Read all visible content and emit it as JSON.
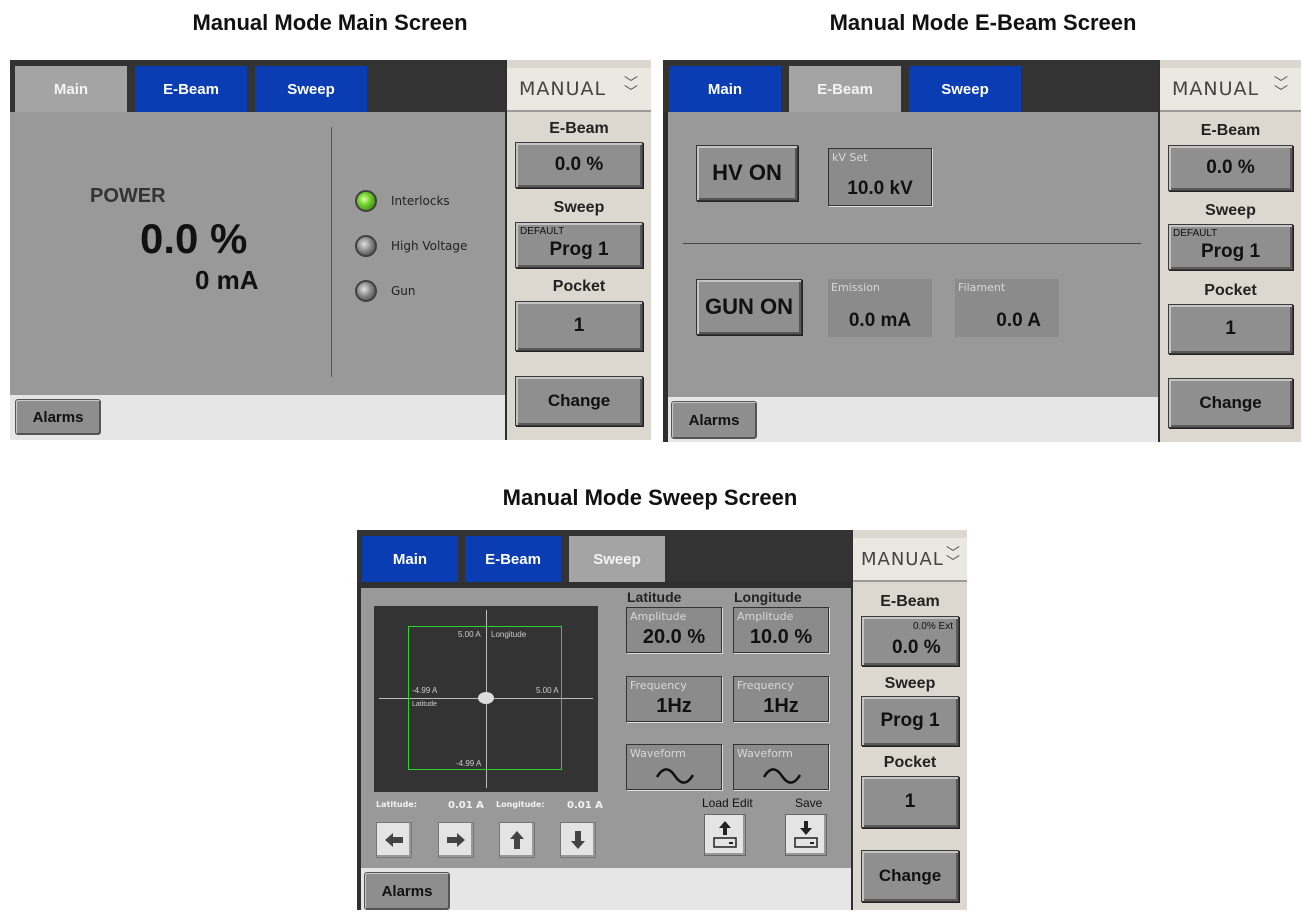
{
  "captions": {
    "main": "Manual Mode Main Screen",
    "ebeam": "Manual Mode E-Beam Screen",
    "sweep": "Manual Mode Sweep Screen"
  },
  "tabs": {
    "main": "Main",
    "ebeam": "E-Beam",
    "sweep": "Sweep"
  },
  "side": {
    "mode": "MANUAL",
    "ebeam_label": "E-Beam",
    "ebeam_value": "0.0 %",
    "ebeam_ext": "0.0% Ext",
    "sweep_label": "Sweep",
    "sweep_default": "DEFAULT",
    "sweep_prog": "Prog 1",
    "pocket_label": "Pocket",
    "pocket_value": "1",
    "change": "Change"
  },
  "alarms": "Alarms",
  "main_screen": {
    "power_label": "POWER",
    "power_value": "0.0 %",
    "current_value": "0 mA",
    "leds": [
      {
        "label": "Interlocks",
        "state": "green"
      },
      {
        "label": "High Voltage",
        "state": "off"
      },
      {
        "label": "Gun",
        "state": "off"
      }
    ]
  },
  "ebeam_screen": {
    "hv_button": "HV ON",
    "kv_label": "kV Set",
    "kv_value": "10.0 kV",
    "gun_button": "GUN ON",
    "emission_label": "Emission",
    "emission_value": "0.0 mA",
    "filament_label": "Filament",
    "filament_value": "0.0 A"
  },
  "sweep_screen": {
    "plot": {
      "top": "5.00 A",
      "longitude_axis": "Longitude",
      "left": "-4.99 A",
      "right": "5.00 A",
      "latitude_axis": "Latitude",
      "bottom": "-4.99 A"
    },
    "latitude_header": "Latitude",
    "longitude_header": "Longitude",
    "amplitude_label": "Amplitude",
    "lat_amplitude": "20.0 %",
    "lon_amplitude": "10.0 %",
    "frequency_label": "Frequency",
    "lat_frequency": "1Hz",
    "lon_frequency": "1Hz",
    "waveform_label": "Waveform",
    "step_lat_label": "Latitude:",
    "step_lat_value": "0.01 A",
    "step_lon_label": "Longitude:",
    "step_lon_value": "0.01 A",
    "load_edit": "Load Edit",
    "save": "Save"
  },
  "colors": {
    "tab_blue": "#0a3cb4",
    "tab_active": "#a4a4a4",
    "content_gray": "#999999",
    "led_green": "#6fce2c",
    "plot_box_green": "#2ed12e"
  }
}
